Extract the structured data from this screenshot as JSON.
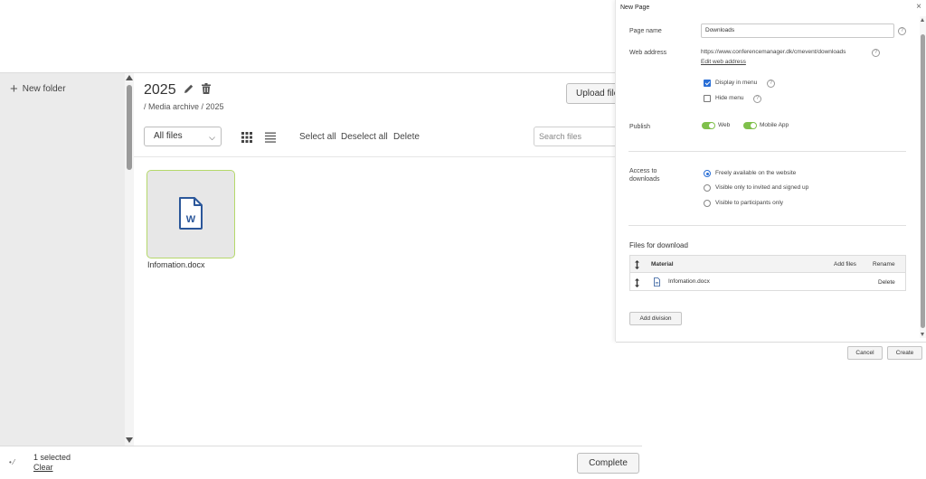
{
  "sidebar": {
    "new_folder_label": "New folder"
  },
  "folder": {
    "name": "2025",
    "breadcrumb": "/ Media archive / 2025",
    "upload_label": "Upload files"
  },
  "toolbar": {
    "filter_value": "All files",
    "select_all": "Select all",
    "deselect_all": "Deselect all",
    "delete": "Delete",
    "search_placeholder": "Search files"
  },
  "files": [
    {
      "name": "Infomation.docx",
      "type_letter": "W",
      "selected": true
    }
  ],
  "bottom_bar": {
    "selected_count": "1 selected",
    "clear_label": "Clear",
    "complete_label": "Complete"
  },
  "dialog": {
    "title": "New Page",
    "close_glyph": "×",
    "page_name_label": "Page name",
    "page_name_value": "Downloads",
    "web_address_label": "Web address",
    "web_address_value": "https://www.conferencemanager.dk/cmevent/downloads",
    "edit_web_address": "Edit web address",
    "display_in_menu": "Display in menu",
    "hide_menu": "Hide menu",
    "publish_label": "Publish",
    "publish_web": "Web",
    "publish_app": "Mobile App",
    "access_label_line1": "Access to",
    "access_label_line2": "downloads",
    "access_options": [
      "Freely available on the website",
      "Visible only to invited and signed up",
      "Visible to participants only"
    ],
    "files_section_title": "Files for download",
    "table": {
      "col_material": "Material",
      "add_files": "Add files",
      "rename": "Rename",
      "row_file": "Infomation.docx",
      "row_delete": "Delete"
    },
    "add_division": "Add division",
    "cancel": "Cancel",
    "create": "Create"
  },
  "colors": {
    "accent_blue": "#2a6fd6",
    "toggle_green": "#7fc04b",
    "selected_border": "#b5d86b",
    "doc_icon_blue": "#2b579a"
  }
}
